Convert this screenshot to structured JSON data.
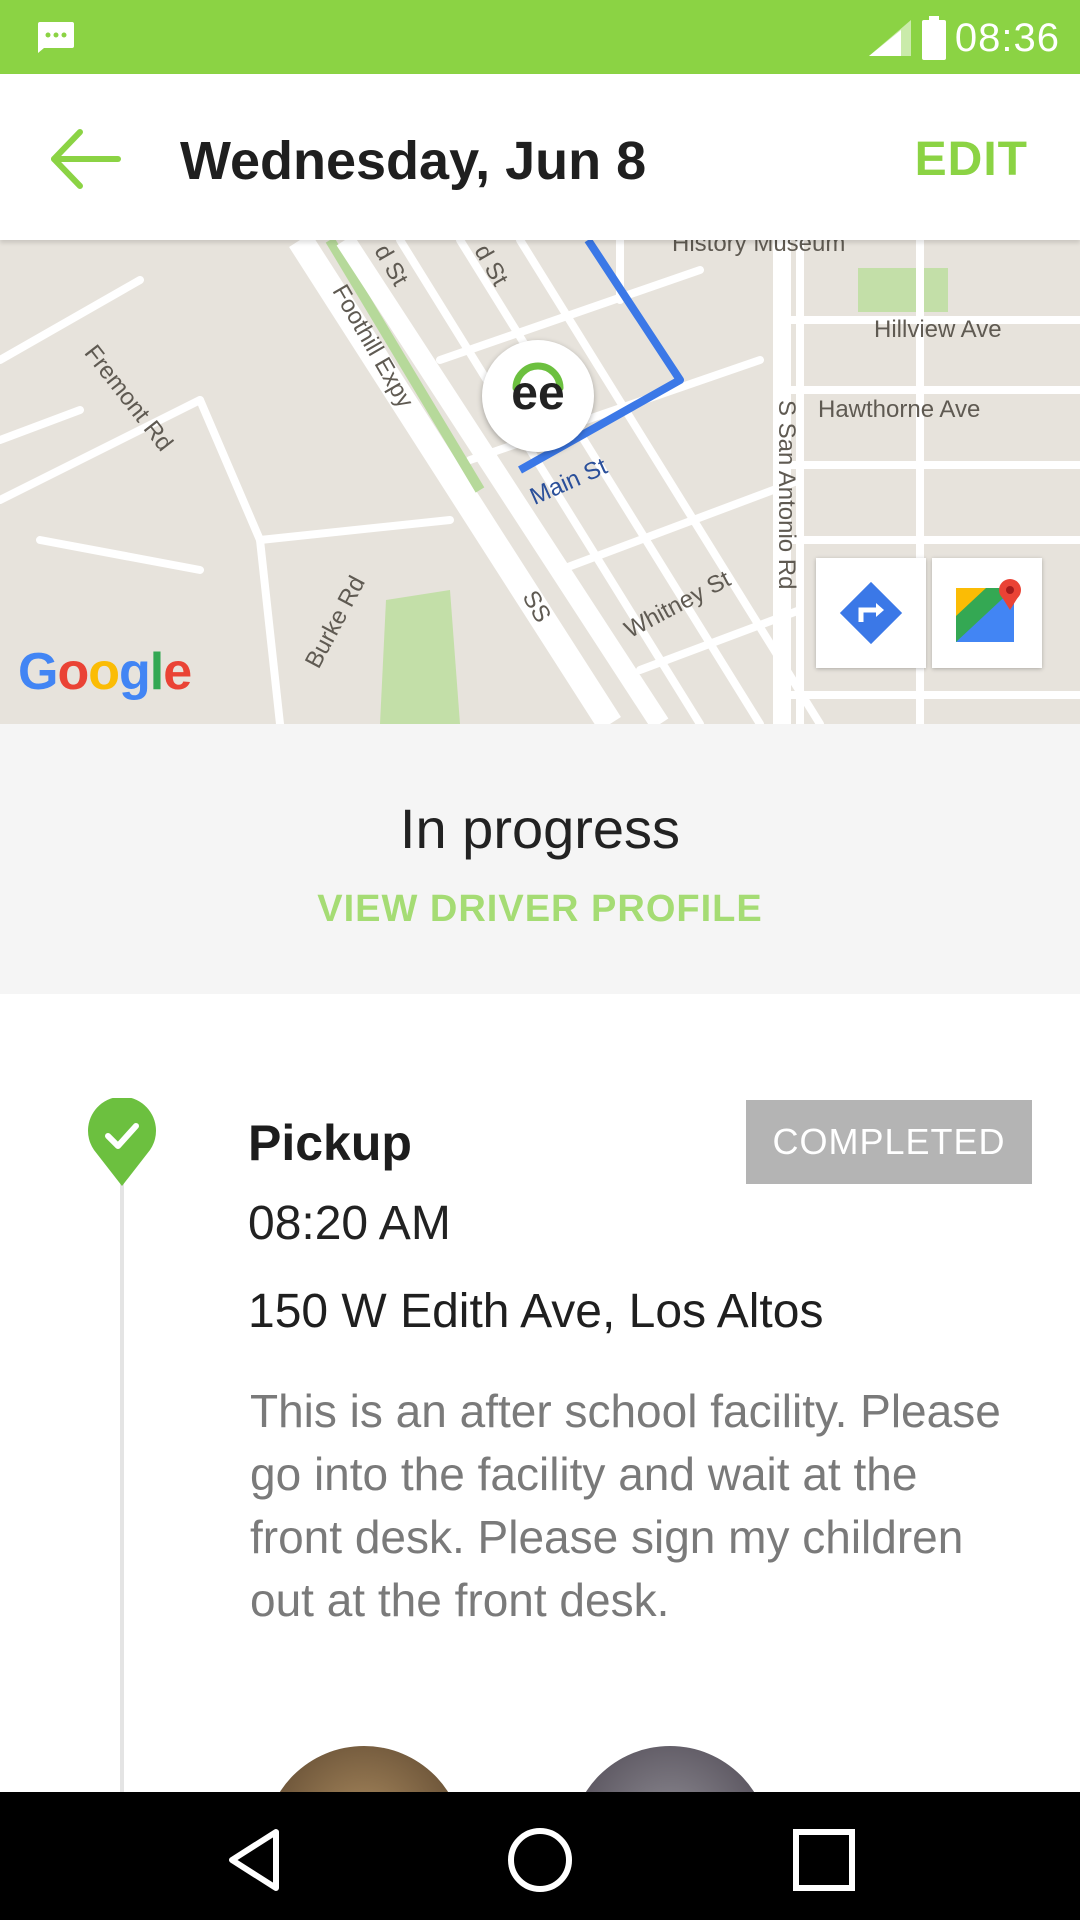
{
  "status_bar": {
    "time": "08:36",
    "colors": {
      "background": "#8bd344"
    },
    "icons": [
      "message-icon",
      "signal-icon",
      "battery-icon"
    ]
  },
  "app_bar": {
    "title": "Wednesday,  Jun 8",
    "edit_label": "EDIT",
    "back_icon": "arrow-back-icon",
    "colors": {
      "accent": "#8bd344"
    }
  },
  "map": {
    "labels": {
      "history_museum": "History Museum",
      "hillview": "Hillview Ave",
      "hawthorne": "Hawthorne Ave",
      "fremont": "Fremont Rd",
      "foothill": "Foothill Expy",
      "burke": "Burke Rd",
      "whitney": "Whitney St",
      "san_antonio": "S San Antonio Rd",
      "main": "Main St",
      "highway": "SS",
      "st1": "d St",
      "st2": "d St"
    },
    "marker_text": "ee",
    "google_logo": {
      "letters": [
        "G",
        "o",
        "o",
        "g",
        "l",
        "e"
      ],
      "colors": [
        "#4285f4",
        "#ea4335",
        "#fbbc05",
        "#4285f4",
        "#34a853",
        "#ea4335"
      ]
    },
    "buttons": [
      "directions-icon",
      "google-maps-icon"
    ],
    "route_color": "#3b78e7"
  },
  "trip_status": {
    "status": "In progress",
    "driver_link": "VIEW DRIVER PROFILE"
  },
  "stop": {
    "title": "Pickup",
    "badge": "COMPLETED",
    "time": "08:20 AM",
    "address": "150 W Edith Ave, Los Altos",
    "note": "This is an after school facility. Please go into the facility and wait at the front desk. Please sign my children out at the front desk.",
    "icon": "check-pin-icon",
    "colors": {
      "pin": "#6cc03f",
      "badge": "#b4b4b4"
    }
  },
  "nav_bar": {
    "buttons": [
      "nav-back-icon",
      "nav-home-icon",
      "nav-recents-icon"
    ]
  }
}
